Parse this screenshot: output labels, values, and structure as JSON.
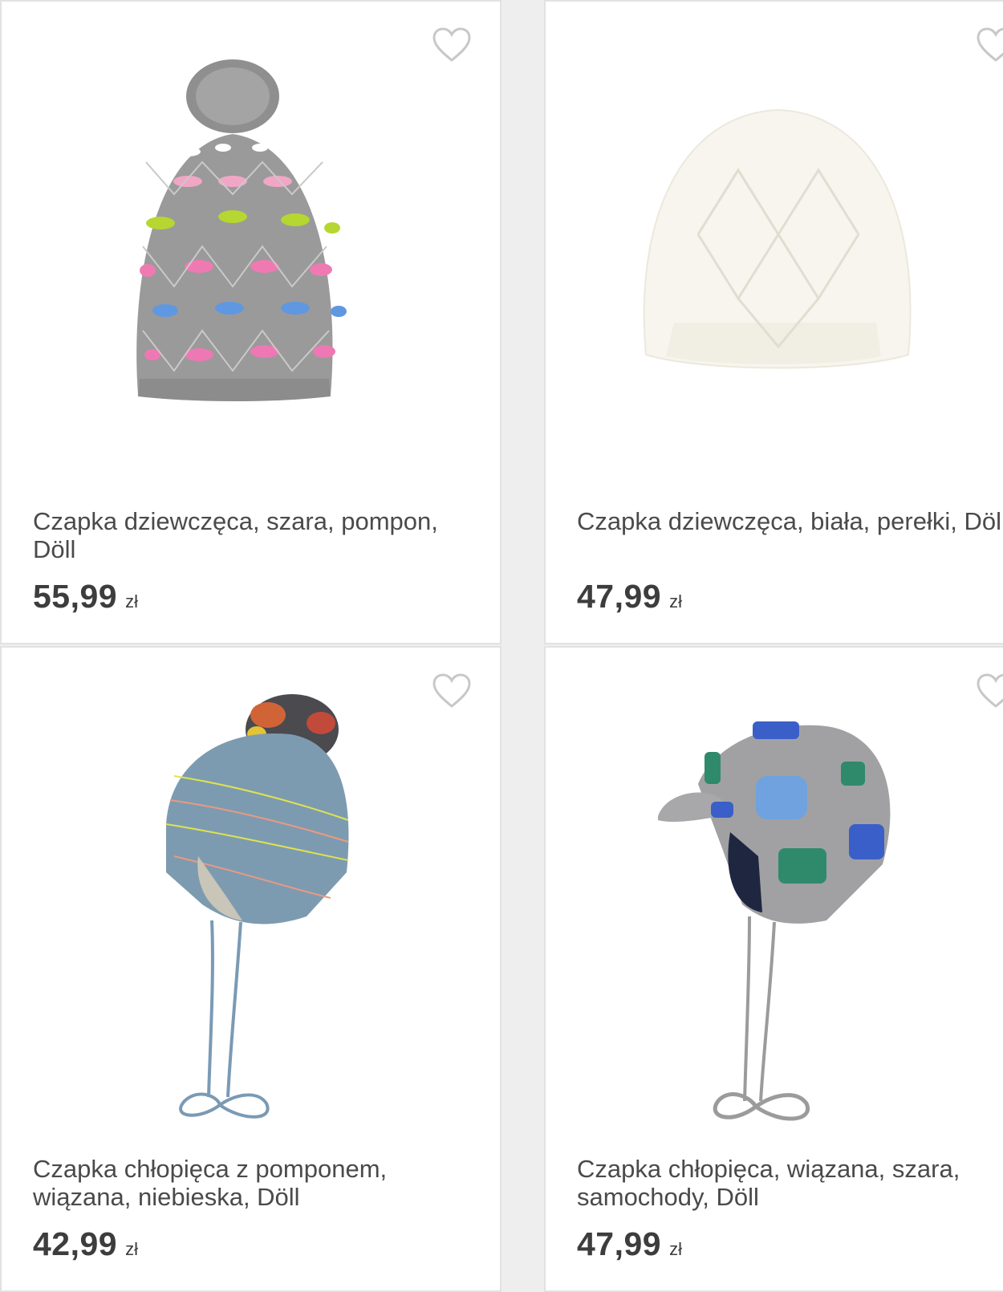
{
  "products": [
    {
      "title": "Czapka dziewczęca, szara, pompon, Döll",
      "price": "55,99",
      "currency": "zł",
      "image": "grey-pompom-beanie",
      "wishlist_icon": "heart-outline-icon"
    },
    {
      "title": "Czapka dziewczęca, biała, perełki, Döll",
      "price": "47,99",
      "currency": "zł",
      "image": "white-knit-beanie",
      "wishlist_icon": "heart-outline-icon"
    },
    {
      "title": "Czapka chłopięca z pomponem, wiązana, niebieska, Döll",
      "price": "42,99",
      "currency": "zł",
      "image": "blue-pompom-tie-hat",
      "wishlist_icon": "heart-outline-icon"
    },
    {
      "title": "Czapka chłopięca, wiązana, szara, samochody, Döll",
      "price": "47,99",
      "currency": "zł",
      "image": "grey-car-pattern-cap",
      "wishlist_icon": "heart-outline-icon"
    }
  ],
  "colors": {
    "card_bg": "#ffffff",
    "page_bg": "#eeeeee",
    "text": "#4a4a4a",
    "icon": "#c8c8c8"
  }
}
